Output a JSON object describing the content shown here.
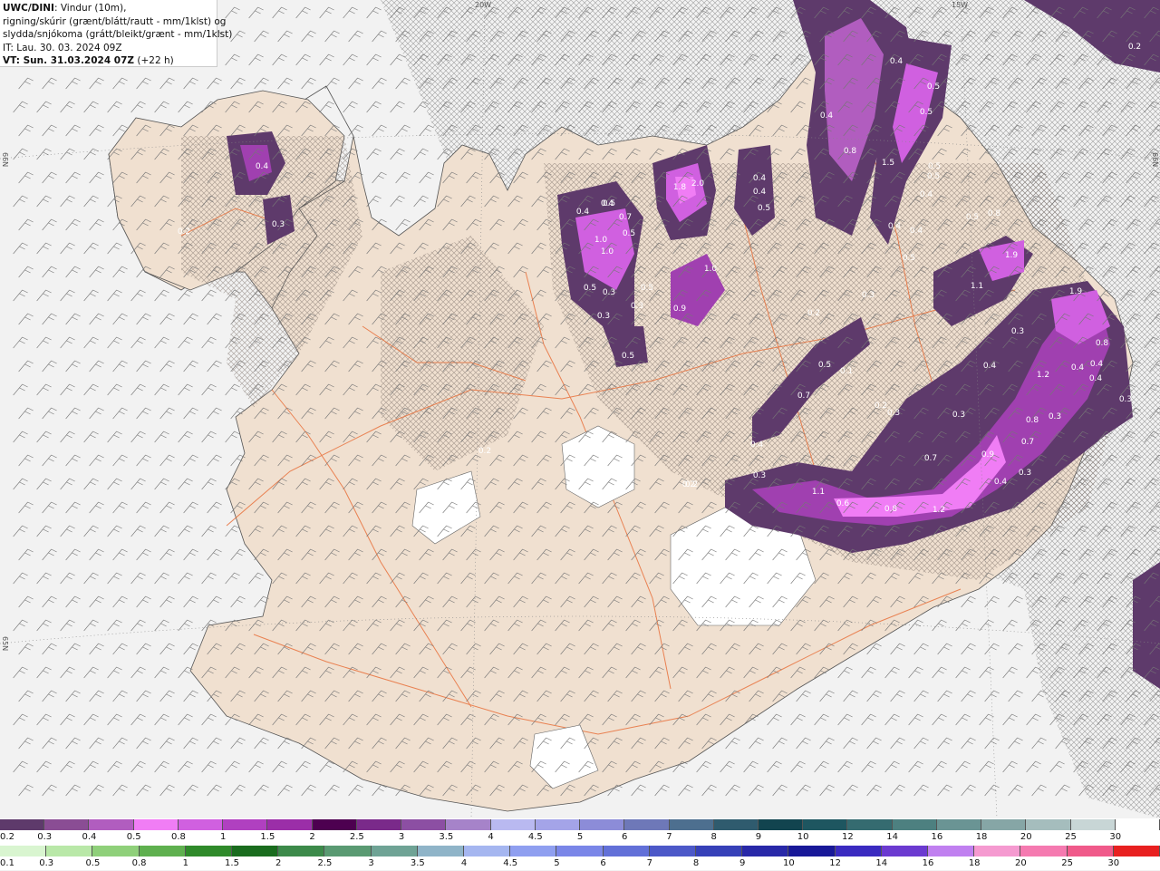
{
  "header": {
    "model": "UWC/DINI",
    "line1_rest": ": Vindur (10m),",
    "line2": "rigning/skúrir (grænt/blátt/rautt - mm/1klst) og",
    "line3": "slydda/snjókoma (grátt/bleikt/grænt - mm/1klst)",
    "line4": "IT: Lau. 30. 03. 2024 09Z",
    "line5_bold": "VT: Sun. 31.03.2024 07Z",
    "line5_rest": " (+22 h)"
  },
  "colors": {
    "sea": "#f2f2f2",
    "land": "#f0e0d0",
    "roads": "#e8713c",
    "glacier": "#ffffff",
    "precip_light": "#5e3a6b",
    "precip_mid": "#a040b0",
    "precip_high": "#d060e0",
    "precip_peak": "#f07df5"
  },
  "grid_labels": [
    "20W",
    "15W",
    "66N",
    "66N",
    "65N"
  ],
  "precip_labels": [
    "0.2",
    "0.4",
    "0.5",
    "0.4",
    "0.5",
    "0.8",
    "1.5",
    "0.4",
    "0.5",
    "1.8",
    "2.0",
    "0.4",
    "0.4",
    "0.5",
    "0.5",
    "0.4",
    "0.4",
    "0.4",
    "0.5",
    "0.8",
    "0.3",
    "0.2",
    "0.4",
    "0.4",
    "0.5",
    "0.7",
    "0.5",
    "1.0",
    "1.0",
    "0.5",
    "0.3",
    "0.3",
    "0.5",
    "0.3",
    "0.5",
    "1.0",
    "0.9",
    "0.2",
    "0.3",
    "1.9",
    "1.1",
    "1.9",
    "0.3",
    "0.5",
    "0.1",
    "0.7",
    "0.4",
    "0.4",
    "1.2",
    "0.8",
    "0.4",
    "0.5",
    "0.4",
    "0.3",
    "0.2",
    "0.3",
    "0.3",
    "0.8",
    "0.7",
    "0.7",
    "0.9",
    "0.3",
    "0.4",
    "0.4",
    "0.2",
    "0.3",
    "1.1",
    "0.6",
    "0.8",
    "1.2",
    "0.3",
    "0.2",
    "0.2"
  ],
  "legend": {
    "snow": {
      "labels": [
        "0.2",
        "0.3",
        "0.4",
        "0.5",
        "0.8",
        "1",
        "1.5",
        "2",
        "2.5",
        "3",
        "3.5",
        "4",
        "4.5",
        "5",
        "6",
        "7",
        "8",
        "9",
        "10",
        "12",
        "14",
        "16",
        "18",
        "20",
        "25",
        "30"
      ],
      "colors": [
        "#5e3a6b",
        "#8a4d94",
        "#b15dbf",
        "#f07df5",
        "#d060e0",
        "#b040c0",
        "#9b2ea8",
        "#4d0050",
        "#7a2a8a",
        "#8c4fa3",
        "#a683c9",
        "#b9b9f0",
        "#a4a4e8",
        "#8c8cd8",
        "#6e78b8",
        "#4d6f8f",
        "#2f5b6e",
        "#12444f",
        "#1e5660",
        "#356b70",
        "#4d8080",
        "#6a9494",
        "#86a6a6",
        "#a5bdbd",
        "#c8d6d6",
        "#ffffff"
      ]
    },
    "rain": {
      "labels": [
        "0.1",
        "0.3",
        "0.5",
        "0.8",
        "1",
        "1.5",
        "2",
        "2.5",
        "3",
        "3.5",
        "4",
        "4.5",
        "5",
        "6",
        "7",
        "8",
        "9",
        "10",
        "12",
        "14",
        "16",
        "18",
        "20",
        "25",
        "30"
      ],
      "colors": [
        "#d9f5d0",
        "#b9e8a8",
        "#8fd07a",
        "#5fb04f",
        "#2f8a2a",
        "#1a6c1e",
        "#3c8a4a",
        "#5a9a72",
        "#6fa395",
        "#8fb4c8",
        "#a5b6f0",
        "#8f9ff0",
        "#7a86e8",
        "#6270d8",
        "#4c58c8",
        "#3640b8",
        "#2828a8",
        "#181898",
        "#3a2ac0",
        "#6b3ad0",
        "#c080f0",
        "#f59ad0",
        "#f57ab0",
        "#f05a8a",
        "#e82020"
      ]
    }
  }
}
